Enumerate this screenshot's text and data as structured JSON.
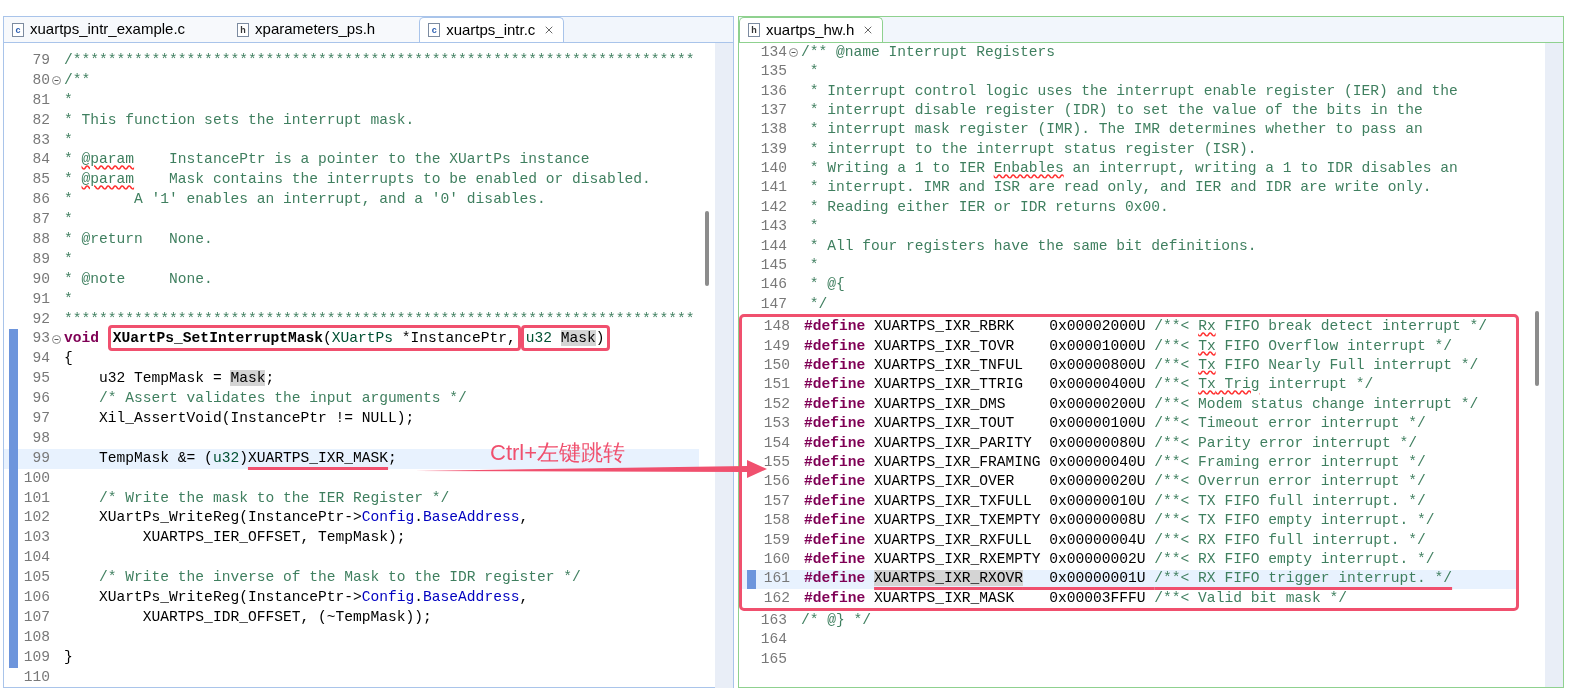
{
  "left_editor": {
    "tabs": [
      {
        "label": "xuartps_intr_example.c",
        "file_type": "c",
        "selected": false
      },
      {
        "label": "xparameters_ps.h",
        "file_type": "h",
        "selected": false
      },
      {
        "label": "xuartps_intr.c",
        "file_type": "c",
        "selected": true
      }
    ],
    "lines": [
      {
        "number": "79",
        "segments": [
          {
            "text": "/***********************************************************************",
            "kind": "comment"
          }
        ]
      },
      {
        "number": "80",
        "fold": true,
        "segments": [
          {
            "text": "/**",
            "kind": "comment"
          }
        ]
      },
      {
        "number": "81",
        "segments": [
          {
            "text": "*",
            "kind": "comment"
          }
        ]
      },
      {
        "number": "82",
        "segments": [
          {
            "text": "* This function sets the interrupt mask.",
            "kind": "comment"
          }
        ]
      },
      {
        "number": "83",
        "segments": [
          {
            "text": "*",
            "kind": "comment"
          }
        ]
      },
      {
        "number": "84",
        "segments": [
          {
            "text": "* ",
            "kind": "comment"
          },
          {
            "text": "@param",
            "kind": "misspelled"
          },
          {
            "text": "    InstancePtr is a pointer to the XUartPs instance",
            "kind": "comment"
          }
        ]
      },
      {
        "number": "85",
        "segments": [
          {
            "text": "* ",
            "kind": "comment"
          },
          {
            "text": "@param",
            "kind": "misspelled"
          },
          {
            "text": "    Mask contains the interrupts to be enabled or disabled.",
            "kind": "comment"
          }
        ]
      },
      {
        "number": "86",
        "segments": [
          {
            "text": "*       A '1' enables an interrupt, and a '0' disables.",
            "kind": "comment"
          }
        ]
      },
      {
        "number": "87",
        "segments": [
          {
            "text": "*",
            "kind": "comment"
          }
        ]
      },
      {
        "number": "88",
        "segments": [
          {
            "text": "* @return   None.",
            "kind": "comment"
          }
        ]
      },
      {
        "number": "89",
        "segments": [
          {
            "text": "*",
            "kind": "comment"
          }
        ]
      },
      {
        "number": "90",
        "segments": [
          {
            "text": "* @note     None.",
            "kind": "comment"
          }
        ]
      },
      {
        "number": "91",
        "segments": [
          {
            "text": "*",
            "kind": "comment"
          }
        ]
      },
      {
        "number": "92",
        "segments": [
          {
            "text": "************************************************************************",
            "kind": "comment"
          }
        ]
      },
      {
        "number": "93",
        "fold": true,
        "changed": true,
        "segments": [
          {
            "text": "void ",
            "kind": "keyword"
          },
          {
            "kind": "box",
            "tokens": [
              {
                "text": "XUartPs_SetInterruptMask",
                "kind": "decl"
              },
              {
                "text": "(",
                "kind": "code"
              },
              {
                "text": "XUartPs",
                "kind": "type"
              },
              {
                "text": " *InstancePtr,",
                "kind": "code"
              }
            ]
          },
          {
            "kind": "box",
            "tokens": [
              {
                "text": "u32 ",
                "kind": "type"
              },
              {
                "text": "Mask",
                "kind": "occurrence"
              },
              {
                "text": ")",
                "kind": "code"
              }
            ]
          }
        ]
      },
      {
        "number": "94",
        "changed": true,
        "segments": [
          {
            "text": "{",
            "kind": "code"
          }
        ]
      },
      {
        "number": "95",
        "changed": true,
        "segments": [
          {
            "text": "    u32 TempMask = ",
            "kind": "code"
          },
          {
            "text": "Mask",
            "kind": "occurrence"
          },
          {
            "text": ";",
            "kind": "code"
          }
        ]
      },
      {
        "number": "96",
        "changed": true,
        "segments": [
          {
            "text": "    /* Assert validates the input arguments */",
            "kind": "comment"
          }
        ]
      },
      {
        "number": "97",
        "changed": true,
        "segments": [
          {
            "text": "    Xil_AssertVoid(InstancePtr != NULL);",
            "kind": "code"
          }
        ]
      },
      {
        "number": "98",
        "changed": true
      },
      {
        "number": "99",
        "changed": true,
        "current": true,
        "segments": [
          {
            "text": "    TempMask &= (",
            "kind": "code"
          },
          {
            "text": "u32",
            "kind": "type"
          },
          {
            "text": ")",
            "kind": "code"
          },
          {
            "text": "XUARTPS_IXR_MASK",
            "kind": "code",
            "underlined": true
          },
          {
            "text": ";",
            "kind": "code"
          }
        ]
      },
      {
        "number": "100",
        "changed": true
      },
      {
        "number": "101",
        "changed": true,
        "segments": [
          {
            "text": "    /* Write the mask to the IER Register */",
            "kind": "comment"
          }
        ]
      },
      {
        "number": "102",
        "changed": true,
        "segments": [
          {
            "text": "    XUartPs_WriteReg(InstancePtr->",
            "kind": "code"
          },
          {
            "text": "Config",
            "kind": "member"
          },
          {
            "text": ".",
            "kind": "code"
          },
          {
            "text": "BaseAddress",
            "kind": "member"
          },
          {
            "text": ",",
            "kind": "code"
          }
        ]
      },
      {
        "number": "103",
        "changed": true,
        "segments": [
          {
            "text": "         XUARTPS_IER_OFFSET, TempMask);",
            "kind": "code"
          }
        ]
      },
      {
        "number": "104",
        "changed": true
      },
      {
        "number": "105",
        "changed": true,
        "segments": [
          {
            "text": "    /* Write the inverse of the Mask to the IDR register */",
            "kind": "comment"
          }
        ]
      },
      {
        "number": "106",
        "changed": true,
        "segments": [
          {
            "text": "    XUartPs_WriteReg(InstancePtr->",
            "kind": "code"
          },
          {
            "text": "Config",
            "kind": "member"
          },
          {
            "text": ".",
            "kind": "code"
          },
          {
            "text": "BaseAddress",
            "kind": "member"
          },
          {
            "text": ",",
            "kind": "code"
          }
        ]
      },
      {
        "number": "107",
        "changed": true,
        "segments": [
          {
            "text": "         XUARTPS_IDR_OFFSET, (~TempMask));",
            "kind": "code"
          }
        ]
      },
      {
        "number": "108",
        "changed": true
      },
      {
        "number": "109",
        "changed": true,
        "segments": [
          {
            "text": "}",
            "kind": "code"
          }
        ]
      },
      {
        "number": "110"
      }
    ]
  },
  "right_editor": {
    "tabs": [
      {
        "label": "xuartps_hw.h",
        "file_type": "h",
        "selected": true
      }
    ],
    "lines": [
      {
        "number": "134",
        "fold": true,
        "segments": [
          {
            "text": "/** @name Interrupt Registers",
            "kind": "comment"
          }
        ]
      },
      {
        "number": "135",
        "segments": [
          {
            "text": " *",
            "kind": "comment"
          }
        ]
      },
      {
        "number": "136",
        "segments": [
          {
            "text": " * Interrupt control logic uses the interrupt enable register (IER) and the",
            "kind": "comment"
          }
        ]
      },
      {
        "number": "137",
        "segments": [
          {
            "text": " * interrupt disable register (IDR) to set the value of the bits in the",
            "kind": "comment"
          }
        ]
      },
      {
        "number": "138",
        "segments": [
          {
            "text": " * interrupt mask register (IMR). The IMR determines whether to pass an",
            "kind": "comment"
          }
        ]
      },
      {
        "number": "139",
        "segments": [
          {
            "text": " * interrupt to the interrupt status register (ISR).",
            "kind": "comment"
          }
        ]
      },
      {
        "number": "140",
        "segments": [
          {
            "text": " * Writing a 1 to IER ",
            "kind": "comment"
          },
          {
            "text": "Enbables",
            "kind": "misspelled"
          },
          {
            "text": " an interrupt, writing a 1 to IDR disables an",
            "kind": "comment"
          }
        ]
      },
      {
        "number": "141",
        "segments": [
          {
            "text": " * interrupt. IMR and ISR are read only, and IER and IDR are write only.",
            "kind": "comment"
          }
        ]
      },
      {
        "number": "142",
        "segments": [
          {
            "text": " * Reading either IER or IDR returns 0x00.",
            "kind": "comment"
          }
        ]
      },
      {
        "number": "143",
        "segments": [
          {
            "text": " *",
            "kind": "comment"
          }
        ]
      },
      {
        "number": "144",
        "segments": [
          {
            "text": " * All four registers have the same bit definitions.",
            "kind": "comment"
          }
        ]
      },
      {
        "number": "145",
        "segments": [
          {
            "text": " *",
            "kind": "comment"
          }
        ]
      },
      {
        "number": "146",
        "segments": [
          {
            "text": " * @{",
            "kind": "comment"
          }
        ]
      },
      {
        "number": "147",
        "segments": [
          {
            "text": " */",
            "kind": "comment"
          }
        ]
      },
      {
        "kind": "box",
        "lines": [
          {
            "number": "148",
            "segments": [
              {
                "text": "#define",
                "kind": "keyword"
              },
              {
                "text": " XUARTPS_IXR_RBRK    0x00002000U ",
                "kind": "code"
              },
              {
                "text": "/**< ",
                "kind": "comment"
              },
              {
                "text": "Rx",
                "kind": "misspelled"
              },
              {
                "text": " FIFO break detect interrupt */",
                "kind": "comment"
              }
            ]
          },
          {
            "number": "149",
            "segments": [
              {
                "text": "#define",
                "kind": "keyword"
              },
              {
                "text": " XUARTPS_IXR_TOVR    0x00001000U ",
                "kind": "code"
              },
              {
                "text": "/**< ",
                "kind": "comment"
              },
              {
                "text": "Tx",
                "kind": "misspelled"
              },
              {
                "text": " FIFO Overflow interrupt */",
                "kind": "comment"
              }
            ]
          },
          {
            "number": "150",
            "segments": [
              {
                "text": "#define",
                "kind": "keyword"
              },
              {
                "text": " XUARTPS_IXR_TNFUL   0x00000800U ",
                "kind": "code"
              },
              {
                "text": "/**< ",
                "kind": "comment"
              },
              {
                "text": "Tx",
                "kind": "misspelled"
              },
              {
                "text": " FIFO Nearly Full interrupt */",
                "kind": "comment"
              }
            ]
          },
          {
            "number": "151",
            "segments": [
              {
                "text": "#define",
                "kind": "keyword"
              },
              {
                "text": " XUARTPS_IXR_TTRIG   0x00000400U ",
                "kind": "code"
              },
              {
                "text": "/**< ",
                "kind": "comment"
              },
              {
                "text": "Tx",
                "kind": "misspelled"
              },
              {
                "text": " Trig",
                "kind": "misspelled"
              },
              {
                "text": " interrupt */",
                "kind": "comment"
              }
            ]
          },
          {
            "number": "152",
            "segments": [
              {
                "text": "#define",
                "kind": "keyword"
              },
              {
                "text": " XUARTPS_IXR_DMS     0x00000200U ",
                "kind": "code"
              },
              {
                "text": "/**< Modem status change interrupt */",
                "kind": "comment"
              }
            ]
          },
          {
            "number": "153",
            "segments": [
              {
                "text": "#define",
                "kind": "keyword"
              },
              {
                "text": " XUARTPS_IXR_TOUT    0x00000100U ",
                "kind": "code"
              },
              {
                "text": "/**< Timeout error interrupt */",
                "kind": "comment"
              }
            ]
          },
          {
            "number": "154",
            "segments": [
              {
                "text": "#define",
                "kind": "keyword"
              },
              {
                "text": " XUARTPS_IXR_PARITY  0x00000080U ",
                "kind": "code"
              },
              {
                "text": "/**< Parity error interrupt */",
                "kind": "comment"
              }
            ]
          },
          {
            "number": "155",
            "segments": [
              {
                "text": "#define",
                "kind": "keyword"
              },
              {
                "text": " XUARTPS_IXR_FRAMING 0x00000040U ",
                "kind": "code"
              },
              {
                "text": "/**< Framing error interrupt */",
                "kind": "comment"
              }
            ]
          },
          {
            "number": "156",
            "segments": [
              {
                "text": "#define",
                "kind": "keyword"
              },
              {
                "text": " XUARTPS_IXR_OVER    0x00000020U ",
                "kind": "code"
              },
              {
                "text": "/**< Overrun error interrupt */",
                "kind": "comment"
              }
            ]
          },
          {
            "number": "157",
            "segments": [
              {
                "text": "#define",
                "kind": "keyword"
              },
              {
                "text": " XUARTPS_IXR_TXFULL  0x00000010U ",
                "kind": "code"
              },
              {
                "text": "/**< TX FIFO full interrupt. */",
                "kind": "comment"
              }
            ]
          },
          {
            "number": "158",
            "segments": [
              {
                "text": "#define",
                "kind": "keyword"
              },
              {
                "text": " XUARTPS_IXR_TXEMPTY 0x00000008U ",
                "kind": "code"
              },
              {
                "text": "/**< TX FIFO empty interrupt. */",
                "kind": "comment"
              }
            ]
          },
          {
            "number": "159",
            "segments": [
              {
                "text": "#define",
                "kind": "keyword"
              },
              {
                "text": " XUARTPS_IXR_RXFULL  0x00000004U ",
                "kind": "code"
              },
              {
                "text": "/**< RX FIFO full interrupt. */",
                "kind": "comment"
              }
            ]
          },
          {
            "number": "160",
            "segments": [
              {
                "text": "#define",
                "kind": "keyword"
              },
              {
                "text": " XUARTPS_IXR_RXEMPTY 0x00000002U ",
                "kind": "code"
              },
              {
                "text": "/**< RX FIFO empty interrupt. */",
                "kind": "comment"
              }
            ]
          },
          {
            "number": "161",
            "changed": true,
            "current": true,
            "segments": [
              {
                "text": "#define ",
                "kind": "keyword"
              },
              {
                "text": "XUARTPS_IXR_RXOVR",
                "kind": "occurrence",
                "underlined": true
              },
              {
                "text": "   0x00000001U ",
                "kind": "code",
                "underlined": true
              },
              {
                "text": "/**< RX FIFO trigger interrupt. */",
                "kind": "comment",
                "underlined": true
              }
            ]
          },
          {
            "number": "162",
            "segments": [
              {
                "text": "#define",
                "kind": "keyword"
              },
              {
                "text": " XUARTPS_IXR_MASK    0x00003FFFU ",
                "kind": "code"
              },
              {
                "text": "/**< Valid bit mask */",
                "kind": "comment"
              }
            ]
          }
        ]
      },
      {
        "number": "163",
        "segments": [
          {
            "text": "/* @} */",
            "kind": "comment"
          }
        ]
      },
      {
        "number": "164"
      },
      {
        "number": "165"
      }
    ]
  },
  "annotation": {
    "text": "Ctrl+左键跳转"
  }
}
